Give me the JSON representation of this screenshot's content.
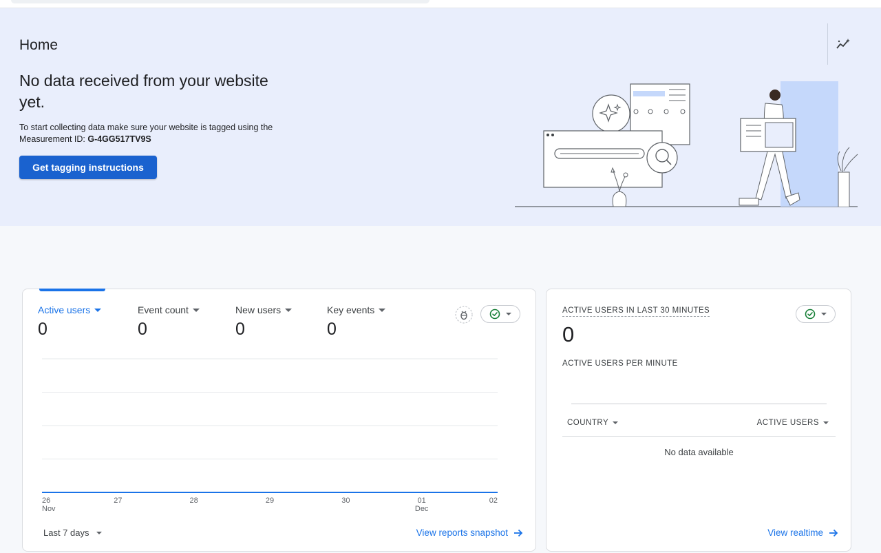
{
  "hero": {
    "page_title": "Home",
    "headline": "No data received from your website yet.",
    "description_prefix": "To start collecting data make sure your website is tagged using the Measurement ID: ",
    "measurement_id": "G-4GG517TV9S",
    "cta_label": "Get tagging instructions",
    "insights_icon": "insights-sparkle-icon"
  },
  "overview_card": {
    "metrics": [
      {
        "label": "Active users",
        "value": "0",
        "selected": true
      },
      {
        "label": "Event count",
        "value": "0",
        "selected": false
      },
      {
        "label": "New users",
        "value": "0",
        "selected": false
      },
      {
        "label": "Key events",
        "value": "0",
        "selected": false
      }
    ],
    "date_range_label": "Last 7 days",
    "view_link_label": "View reports snapshot",
    "compare_icon": "insights-bug-icon",
    "status_icon": "check-circle-icon"
  },
  "chart_data": {
    "type": "line",
    "categories": [
      "26 Nov",
      "27",
      "28",
      "29",
      "30",
      "01 Dec",
      "02"
    ],
    "series": [
      {
        "values": [
          0,
          0,
          0,
          0,
          0,
          0,
          0
        ]
      }
    ],
    "x_tick_labels": [
      {
        "day": "26",
        "month": "Nov"
      },
      {
        "day": "27",
        "month": ""
      },
      {
        "day": "28",
        "month": ""
      },
      {
        "day": "29",
        "month": ""
      },
      {
        "day": "30",
        "month": ""
      },
      {
        "day": "01",
        "month": "Dec"
      },
      {
        "day": "02",
        "month": ""
      }
    ],
    "ylim": [
      0,
      4
    ],
    "grid": true,
    "color": "#1a73e8"
  },
  "realtime_card": {
    "title": "ACTIVE USERS IN LAST 30 MINUTES",
    "value": "0",
    "subtitle": "ACTIVE USERS PER MINUTE",
    "col_country": "COUNTRY",
    "col_active_users": "ACTIVE USERS",
    "empty_text": "No data available",
    "view_link_label": "View realtime",
    "status_icon": "check-circle-icon"
  },
  "colors": {
    "accent": "#1a73e8",
    "cta": "#1a62cf",
    "hero_bg": "#e9eefc",
    "success": "#188038"
  }
}
